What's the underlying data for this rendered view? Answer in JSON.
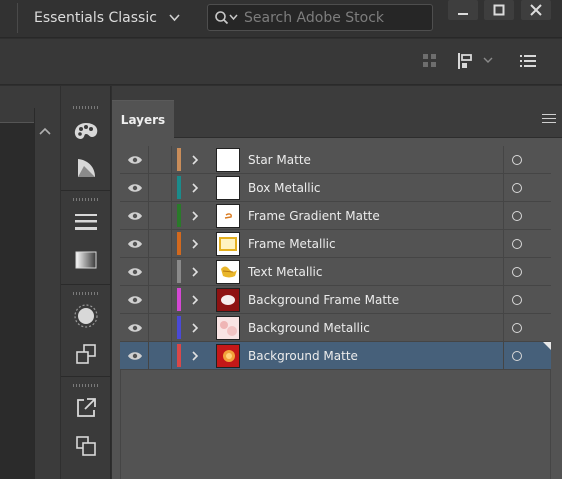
{
  "appbar": {
    "workspace_label": "Essentials Classic",
    "workspace_chevron": "chevron-down-icon",
    "search_placeholder": "Search Adobe Stock",
    "window_controls": [
      "minimize",
      "maximize",
      "close"
    ]
  },
  "dock": {
    "collapse_left": "◂◂",
    "collapse_right": "▸▸"
  },
  "layers_panel": {
    "tab_label": "Layers",
    "menu_icon": "hamburger-icon",
    "layers": [
      {
        "name": "Star Matte",
        "color": "#c98d5a",
        "thumb": "blank",
        "selected": false
      },
      {
        "name": "Box Metallic",
        "color": "#1b8b8b",
        "thumb": "blank",
        "selected": false
      },
      {
        "name": "Frame Gradient Matte",
        "color": "#2a7a2a",
        "thumb": "gradient-stroke",
        "selected": false
      },
      {
        "name": "Frame Metallic",
        "color": "#d2691e",
        "thumb": "gold-frame",
        "selected": false
      },
      {
        "name": "Text Metallic",
        "color": "#8a8a8a",
        "thumb": "gold-text",
        "selected": false
      },
      {
        "name": "Background Frame Matte",
        "color": "#d448d4",
        "thumb": "red-oval",
        "selected": false
      },
      {
        "name": "Background Metallic",
        "color": "#4a4ad6",
        "thumb": "pink-texture",
        "selected": false
      },
      {
        "name": "Background Matte",
        "color": "#d94848",
        "thumb": "red-texture",
        "selected": true
      }
    ]
  }
}
